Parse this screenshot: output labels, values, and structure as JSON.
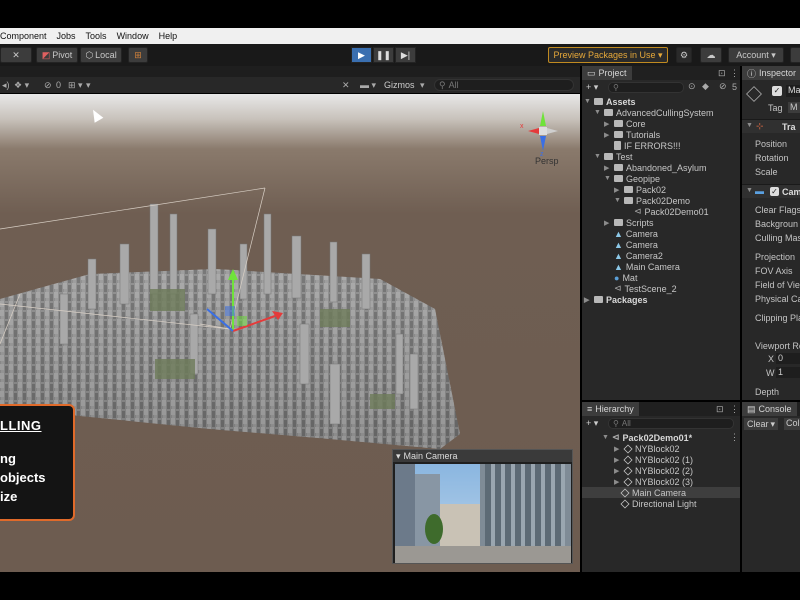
{
  "menu": [
    "Component",
    "Jobs",
    "Tools",
    "Window",
    "Help"
  ],
  "toolbar": {
    "pivot": "Pivot",
    "local": "Local",
    "preview_packages": "Preview Packages in Use ▾",
    "account": "Account ▾"
  },
  "scene_toolbar": {
    "hidden_count": "0",
    "gizmos": "Gizmos",
    "search_placeholder": "All",
    "persp": "Persp"
  },
  "project": {
    "tab": "Project",
    "count": "5",
    "tree": [
      {
        "label": "Assets",
        "bold": true
      },
      {
        "label": "AdvancedCullingSystem"
      },
      {
        "label": "Core"
      },
      {
        "label": "Tutorials"
      },
      {
        "label": "IF ERRORS!!!"
      },
      {
        "label": "Test"
      },
      {
        "label": "Abandoned_Asylum"
      },
      {
        "label": "Geopipe"
      },
      {
        "label": "Pack02"
      },
      {
        "label": "Pack02Demo"
      },
      {
        "label": "Pack02Demo01"
      },
      {
        "label": "Scripts"
      },
      {
        "label": "Camera"
      },
      {
        "label": "Camera"
      },
      {
        "label": "Camera2"
      },
      {
        "label": "Main Camera"
      },
      {
        "label": "Mat"
      },
      {
        "label": "TestScene_2"
      },
      {
        "label": "Packages",
        "bold": true
      }
    ]
  },
  "hierarchy": {
    "tab": "Hierarchy",
    "search_placeholder": "All",
    "scene": "Pack02Demo01*",
    "items": [
      "NYBlock02",
      "NYBlock02 (1)",
      "NYBlock02 (2)",
      "NYBlock02 (3)",
      "Main Camera",
      "Directional Light"
    ]
  },
  "inspector": {
    "tab": "Inspector",
    "name_prefix": "Ma",
    "tag": "Tag",
    "tag_value": "M",
    "transform_header": "Tra",
    "position": "Position",
    "rotation": "Rotation",
    "scale": "Scale",
    "camera_header": "Cam",
    "clear_flags": "Clear Flags",
    "background": "Backgroun",
    "culling_mask": "Culling Mas",
    "projection": "Projection",
    "fov_axis": "FOV Axis",
    "field_of_view": "Field of Vie",
    "physical_camera": "Physical Ca",
    "clipping_planes": "Clipping Pla",
    "viewport_rect": "Viewport Re",
    "x_label": "X",
    "x_value": "0",
    "w_label": "W",
    "w_value": "1",
    "depth": "Depth"
  },
  "console": {
    "tab": "Console",
    "clear": "Clear",
    "collapse": "Coll"
  },
  "camera_preview": {
    "title": "Main Camera"
  },
  "callout": {
    "line1": "LLING",
    "line2": "ng",
    "line3": "objects",
    "line4": "ize"
  },
  "colors": {
    "accent_orange": "#e06a2a",
    "play_blue": "#3a6fb0",
    "preview_gold": "#e6a83a"
  }
}
